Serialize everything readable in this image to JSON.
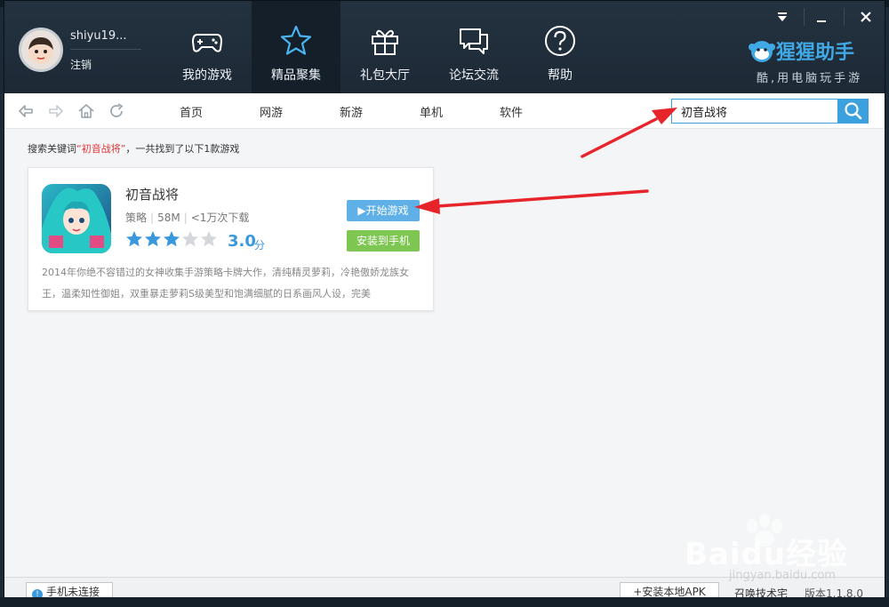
{
  "user": {
    "name": "shiyu19...",
    "logout_label": "注销"
  },
  "nav": {
    "tabs": [
      {
        "label": "我的游戏",
        "icon": "gamepad-icon"
      },
      {
        "label": "精品聚集",
        "icon": "star-icon",
        "active": true
      },
      {
        "label": "礼包大厅",
        "icon": "gift-icon"
      },
      {
        "label": "论坛交流",
        "icon": "chat-icon"
      },
      {
        "label": "帮助",
        "icon": "help-icon"
      }
    ]
  },
  "window_controls": [
    "minimize-to-tray-icon",
    "minimize-icon",
    "close-icon"
  ],
  "brand": {
    "name": "猩猩助手",
    "slogan": "酷,用电脑玩手游",
    "color": "#40a8e4"
  },
  "toolbar": {
    "links": [
      "首页",
      "网游",
      "新游",
      "单机",
      "软件"
    ],
    "search_value": "初音战将"
  },
  "results": {
    "prefix": "搜索关键词",
    "keyword": "“初音战将”",
    "suffix": "，一共找到了以下1款游戏"
  },
  "game": {
    "title": "初音战将",
    "category": "策略",
    "size": "58M",
    "downloads": "<1万次下载",
    "rating": "3.0",
    "rating_unit": "分",
    "stars_filled": 3,
    "stars_total": 5,
    "play_label": "开始游戏",
    "install_label": "安装到手机",
    "description": "2014年你绝不容错过的女神收集手游策略卡牌大作，清纯精灵萝莉，冷艳傲娇龙族女王，温柔知性御姐，双重暴走萝莉S级美型和饱满细腻的日系画风人设，完美"
  },
  "statusbar": {
    "phone_status": "手机未连接",
    "apk_label": "安装本地APK",
    "tech_link": "召唤技术宅",
    "version": "版本1.1.8.0"
  },
  "watermark": {
    "text": "Baidu经验",
    "url": "jingyan.baidu.com"
  },
  "colors": {
    "header_bg": "#1d2935",
    "accent_blue": "#3aa0de",
    "install_green": "#7ec652",
    "arrow_red": "#e8242b"
  }
}
